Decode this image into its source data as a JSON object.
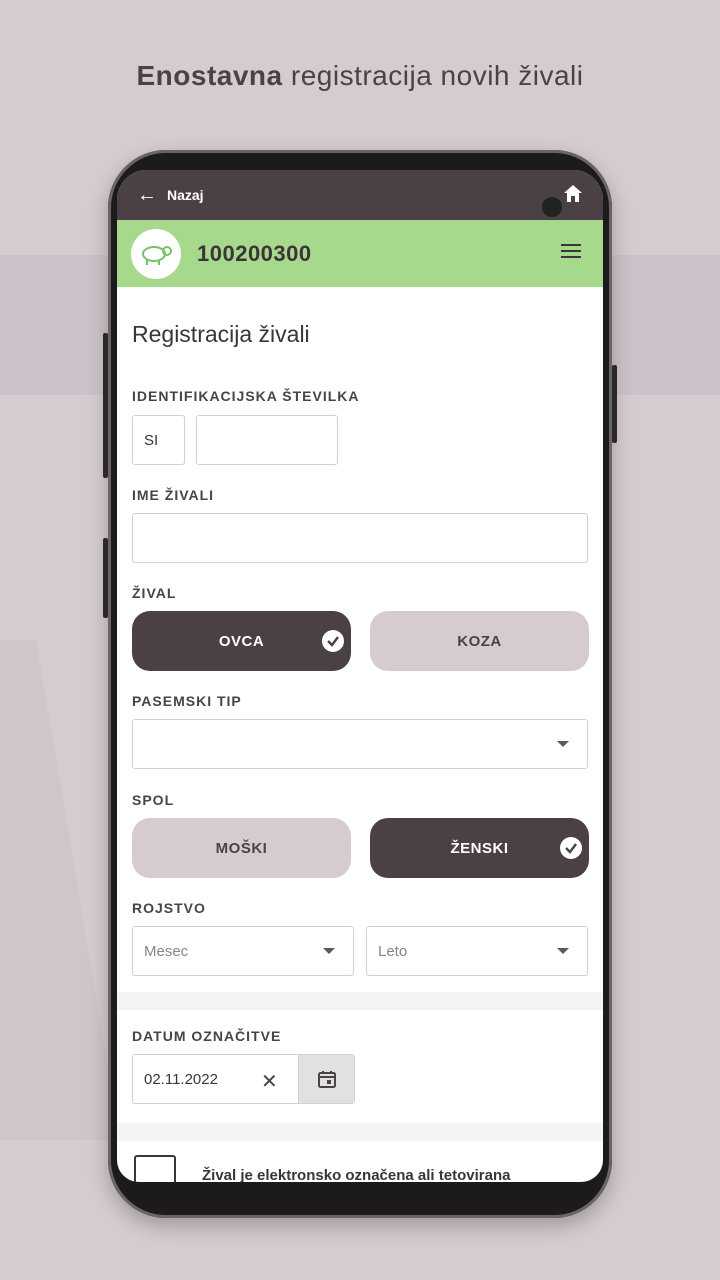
{
  "headline": {
    "bold": "Enostavna",
    "rest": " registracija novih živali"
  },
  "topbar": {
    "back_label": "Nazaj"
  },
  "header": {
    "animal_id": "100200300"
  },
  "form": {
    "title": "Registracija živali",
    "id_label": "IDENTIFIKACIJSKA ŠTEVILKA",
    "id_prefix": "SI",
    "id_value": "",
    "name_label": "IME ŽIVALI",
    "name_value": "",
    "animal_label": "ŽIVAL",
    "animal_options": [
      "OVCA",
      "KOZA"
    ],
    "animal_selected": "OVCA",
    "breed_label": "PASEMSKI TIP",
    "breed_value": "",
    "sex_label": "SPOL",
    "sex_options": [
      "MOŠKI",
      "ŽENSKI"
    ],
    "sex_selected": "ŽENSKI",
    "birth_label": "ROJSTVO",
    "birth_month_placeholder": "Mesec",
    "birth_year_placeholder": "Leto",
    "tag_date_label": "DATUM OZNAČITVE",
    "tag_date_value": "02.11.2022",
    "electronic_label": "Žival je elektronsko označena ali tetovirana"
  },
  "colors": {
    "accent": "#a6d98b",
    "dark": "#4a4045",
    "muted": "#d5cbd1"
  }
}
